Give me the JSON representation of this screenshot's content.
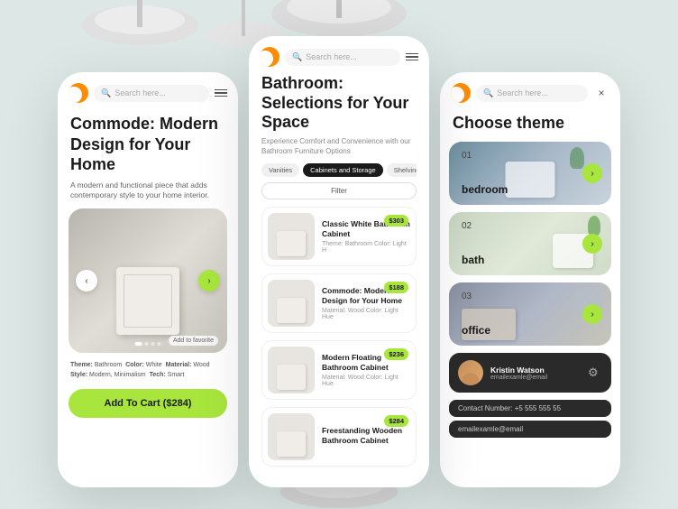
{
  "bg_color": "#dde8e6",
  "phone1": {
    "logo_alt": "brand-logo",
    "search_placeholder": "Search here...",
    "hero_title": "Commode: Modern Design for Your Home",
    "hero_desc": "A modern and functional piece that adds contemporary style to your home interior.",
    "nav_left": "‹",
    "nav_right": "›",
    "fav_label": "Add to favorite",
    "tags": [
      {
        "label": "Theme:",
        "value": "Bathroom"
      },
      {
        "label": "Color:",
        "value": "White"
      },
      {
        "label": "Material:",
        "value": "Wood"
      },
      {
        "label": "Style:",
        "value": "Modern, Minimalism"
      },
      {
        "label": "Tech:",
        "value": "Smart"
      }
    ],
    "cart_button": "Add To Cart ($284)"
  },
  "phone2": {
    "search_placeholder": "Search here...",
    "page_title": "Bathroom: Selections for Your Space",
    "page_desc": "Experience Comfort and Convenience with our Bathroom Furniture Options",
    "filter_tabs": [
      {
        "label": "Vanities",
        "active": false
      },
      {
        "label": "Cabinets and Storage",
        "active": true
      },
      {
        "label": "Shelving and Ro:",
        "active": false
      }
    ],
    "filter_btn": "Filter",
    "products": [
      {
        "name": "Classic White Bathroom Cabinet",
        "meta": "Theme: Bathroom   Color: Light   H",
        "price": "$303"
      },
      {
        "name": "Commode: Modern Design for Your Home",
        "meta": "Material: Wood   Color: Light   Hue",
        "price": "$188"
      },
      {
        "name": "Modern Floating Bathroom Cabinet",
        "meta": "Material: Wood   Color: Light   Hue",
        "price": "$236"
      },
      {
        "name": "Freestanding Wooden Bathroom Cabinet",
        "meta": "",
        "price": "$284"
      }
    ]
  },
  "phone3": {
    "search_placeholder": "Search here...",
    "close_icon": "×",
    "choose_theme_title": "Choose theme",
    "themes": [
      {
        "number": "01",
        "label": "bedroom"
      },
      {
        "number": "02",
        "label": "bath"
      },
      {
        "number": "03",
        "label": "office"
      }
    ],
    "user": {
      "name": "Kristin Watson",
      "email": "emailexamle@email"
    },
    "contact_number": "Contact Number: +5 555 555 55",
    "contact_email": "emailexamle@email"
  }
}
